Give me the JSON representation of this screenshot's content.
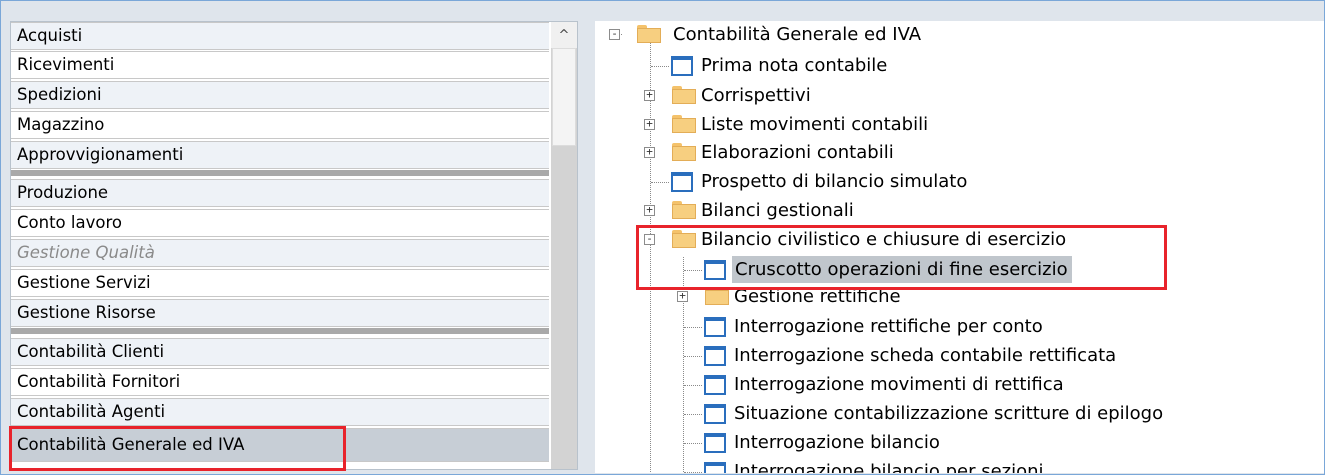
{
  "left_menu": {
    "items": [
      {
        "label": "Acquisti"
      },
      {
        "label": "Ricevimenti"
      },
      {
        "label": "Spedizioni"
      },
      {
        "label": "Magazzino"
      },
      {
        "label": "Approvvigionamenti"
      },
      {
        "label": "Produzione"
      },
      {
        "label": "Conto lavoro"
      },
      {
        "label": "Gestione Qualità"
      },
      {
        "label": "Gestione Servizi"
      },
      {
        "label": "Gestione Risorse"
      },
      {
        "label": "Contabilità Clienti"
      },
      {
        "label": "Contabilità Fornitori"
      },
      {
        "label": "Contabilità Agenti"
      },
      {
        "label": "Contabilità Generale ed IVA"
      }
    ],
    "disabled_item": "Gestione Qualità",
    "selected_item": "Contabilità Generale ed IVA",
    "scroll_up_glyph": "^"
  },
  "tree": {
    "root": "Contabilità Generale ed IVA",
    "nodes": [
      {
        "label": "Prima nota contabile",
        "icon": "form-icon"
      },
      {
        "label": "Corrispettivi",
        "icon": "folder-icon",
        "expander": "+"
      },
      {
        "label": "Liste movimenti contabili",
        "icon": "folder-icon",
        "expander": "+"
      },
      {
        "label": "Elaborazioni contabili",
        "icon": "folder-icon",
        "expander": "+"
      },
      {
        "label": "Prospetto di bilancio simulato",
        "icon": "form-icon"
      },
      {
        "label": "Bilanci gestionali",
        "icon": "folder-icon",
        "expander": "+"
      },
      {
        "label": "Bilancio civilistico e chiusure di esercizio",
        "icon": "folder-icon",
        "expander": "-"
      },
      {
        "label": "Cruscotto operazioni di fine esercizio",
        "icon": "form-icon",
        "selected": true
      },
      {
        "label": "Gestione rettifiche",
        "icon": "folder-icon",
        "expander": "+"
      },
      {
        "label": "Interrogazione rettifiche per conto",
        "icon": "form-icon"
      },
      {
        "label": "Interrogazione scheda contabile rettificata",
        "icon": "form-icon"
      },
      {
        "label": "Interrogazione movimenti di rettifica",
        "icon": "form-icon"
      },
      {
        "label": "Situazione contabilizzazione scritture di epilogo",
        "icon": "form-icon"
      },
      {
        "label": "Interrogazione bilancio",
        "icon": "form-icon"
      },
      {
        "label": "Interrogazione bilancio per sezioni",
        "icon": "form-icon"
      }
    ],
    "expander_collapsed": "+",
    "expander_expanded": "-"
  },
  "colors": {
    "highlight_box": "#e8232b",
    "selected_bg": "#c0c6cc",
    "form_icon": "#2a6ebd",
    "folder": "#f7cf80"
  }
}
